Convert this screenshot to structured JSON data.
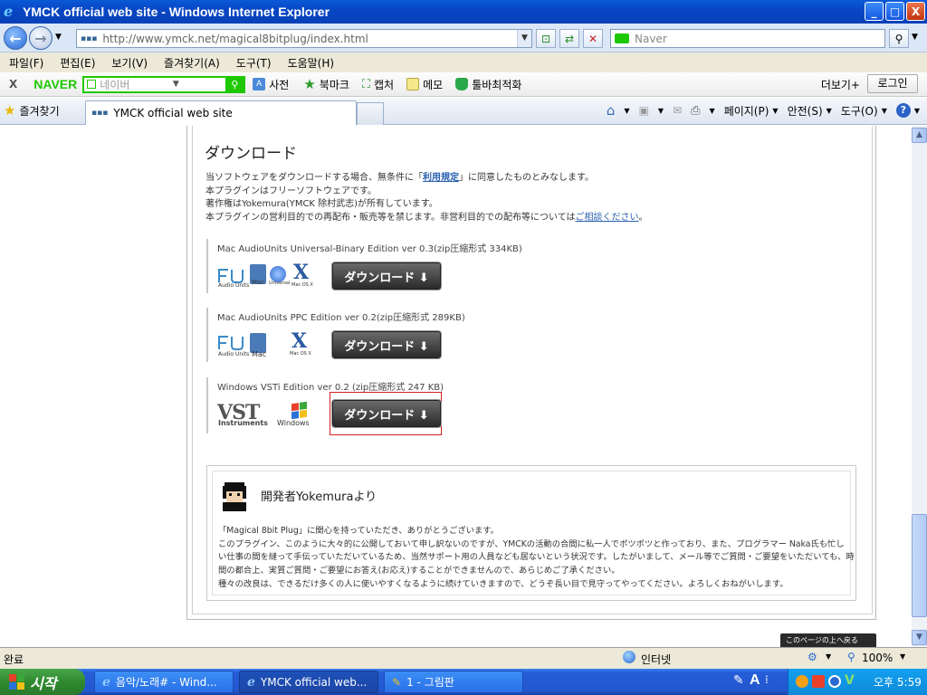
{
  "window": {
    "title": "YMCK official web site - Windows Internet Explorer",
    "minimize": "_",
    "maximize": "□",
    "close": "X"
  },
  "address": {
    "url": "http://www.ymck.net/magical8bitplug/index.html",
    "search_placeholder": "Naver"
  },
  "menu": [
    "파일(F)",
    "편집(E)",
    "보기(V)",
    "즐겨찾기(A)",
    "도구(T)",
    "도움말(H)"
  ],
  "naver": {
    "close": "X",
    "logo": "NAVER",
    "search_placeholder": "네이버",
    "items": [
      "사전",
      "북마크",
      "캡처",
      "메모",
      "툴바최적화"
    ],
    "more": "더보기+",
    "login": "로그인"
  },
  "tabs": {
    "favorites": "즐겨찾기",
    "current": "YMCK official web site"
  },
  "commands": {
    "page": "페이지(P)",
    "safety": "안전(S)",
    "tools": "도구(O)",
    "help": "?"
  },
  "page": {
    "download_heading": "ダウンロード",
    "intro": [
      {
        "pre": "当ソフトウェアをダウンロードする場合、無条件に「",
        "link": "利用規定",
        "post": "」に同意したものとみなします。"
      },
      {
        "pre": "本プラグインはフリーソフトウェアです。",
        "link": "",
        "post": ""
      },
      {
        "pre": "著作権はYokemura(YMCK 除村武志)が所有しています。",
        "link": "",
        "post": ""
      },
      {
        "pre": "本プラグインの営利目的での再配布・販売等を禁じます。非営利目的での配布等については",
        "link": "ご相談ください",
        "post": "。"
      }
    ],
    "downloads": [
      {
        "title": "Mac AudioUnits Universal-Binary Edition ver 0.3(zip圧縮形式 334KB)",
        "button": "ダウンロード ⬇"
      },
      {
        "title": "Mac AudioUnits PPC Edition ver 0.2(zip圧縮形式 289KB)",
        "button": "ダウンロード ⬇"
      },
      {
        "title": "Windows VSTi Edition ver 0.2 (zip圧縮形式 247 KB)",
        "button": "ダウンロード ⬇"
      }
    ],
    "logo_captions": {
      "au": "Audio Units",
      "mac": "Mac",
      "universal": "Universal",
      "osx": "Mac OS X",
      "vst": "Instruments",
      "windows": "Windows"
    },
    "developer_title": "開発者Yokemuraより",
    "developer_lines": [
      "「Magical 8bit Plug」に関心を持っていただき、ありがとうございます。",
      "このプラグイン、このように大々的に公開しておいて申し訳ないのですが、YMCKの活動の合間に私一人でポツポツと作っており、また、プログラマー Naka氏も忙し",
      "い仕事の間を縫って手伝っていただいているため、当然サポート用の人員なども居ないという状況です。したがいまして、メール等でご質問・ご要望をいただいても、時",
      "間の都合上、実質ご質問・ご要望にお答え(お応え)することができませんので、あらじめご了承ください。",
      "種々の改良は、できるだけ多くの人に使いやすくなるように続けていきますので、どうぞ長い目で見守ってやってください。よろしくおねがいします。"
    ],
    "to_top": "このページの上へ戻る"
  },
  "status": {
    "left": "완료",
    "zone": "인터넷",
    "zoom": "100%"
  },
  "taskbar": {
    "start": "시작",
    "tasks": [
      "음악/노래# - Wind...",
      "YMCK official web...",
      "1 - 그림판"
    ],
    "clock": "오후 5:59"
  }
}
